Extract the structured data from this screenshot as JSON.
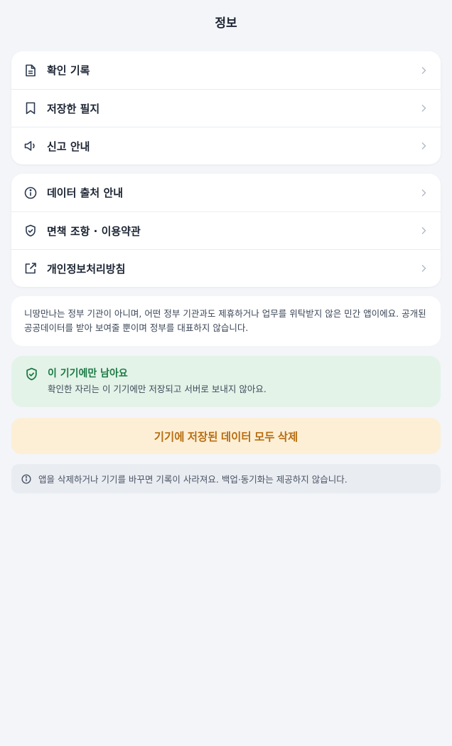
{
  "header": {
    "title": "정보"
  },
  "group1": {
    "items": [
      {
        "label": "확인 기록",
        "icon": "document-icon"
      },
      {
        "label": "저장한 필지",
        "icon": "bookmark-icon"
      },
      {
        "label": "신고 안내",
        "icon": "megaphone-icon"
      }
    ]
  },
  "group2": {
    "items": [
      {
        "label": "데이터 출처 안내",
        "icon": "info-circle-icon"
      },
      {
        "label": "면책 조항 · 이용약관",
        "icon": "shield-check-icon"
      },
      {
        "label": "개인정보처리방침",
        "icon": "external-link-icon"
      }
    ]
  },
  "notice": {
    "text": "니땅만나는 정부 기관이 아니며, 어떤 정부 기관과도 제휴하거나 업무를 위탁받지 않은 민간 앱이에요. 공개된 공공데이터를 받아 보여줄 뿐이며 정부를 대표하지 않습니다."
  },
  "local_notice": {
    "title": "이 기기에만 남아요",
    "description": "확인한 자리는 이 기기에만 저장되고 서버로 보내지 않아요.",
    "icon": "shield-check-icon"
  },
  "delete_button": {
    "label": "기기에 저장된 데이터 모두 삭제"
  },
  "footnote": {
    "text": "앱을 삭제하거나 기기를 바꾸면 기록이 사라져요. 백업·동기화는 제공하지 않습니다.",
    "icon": "info-circle-icon"
  },
  "colors": {
    "background": "#f3f5f9",
    "accent_green": "#1c7a45",
    "warning_text": "#b86e12",
    "warning_bg": "#fcefd6"
  }
}
